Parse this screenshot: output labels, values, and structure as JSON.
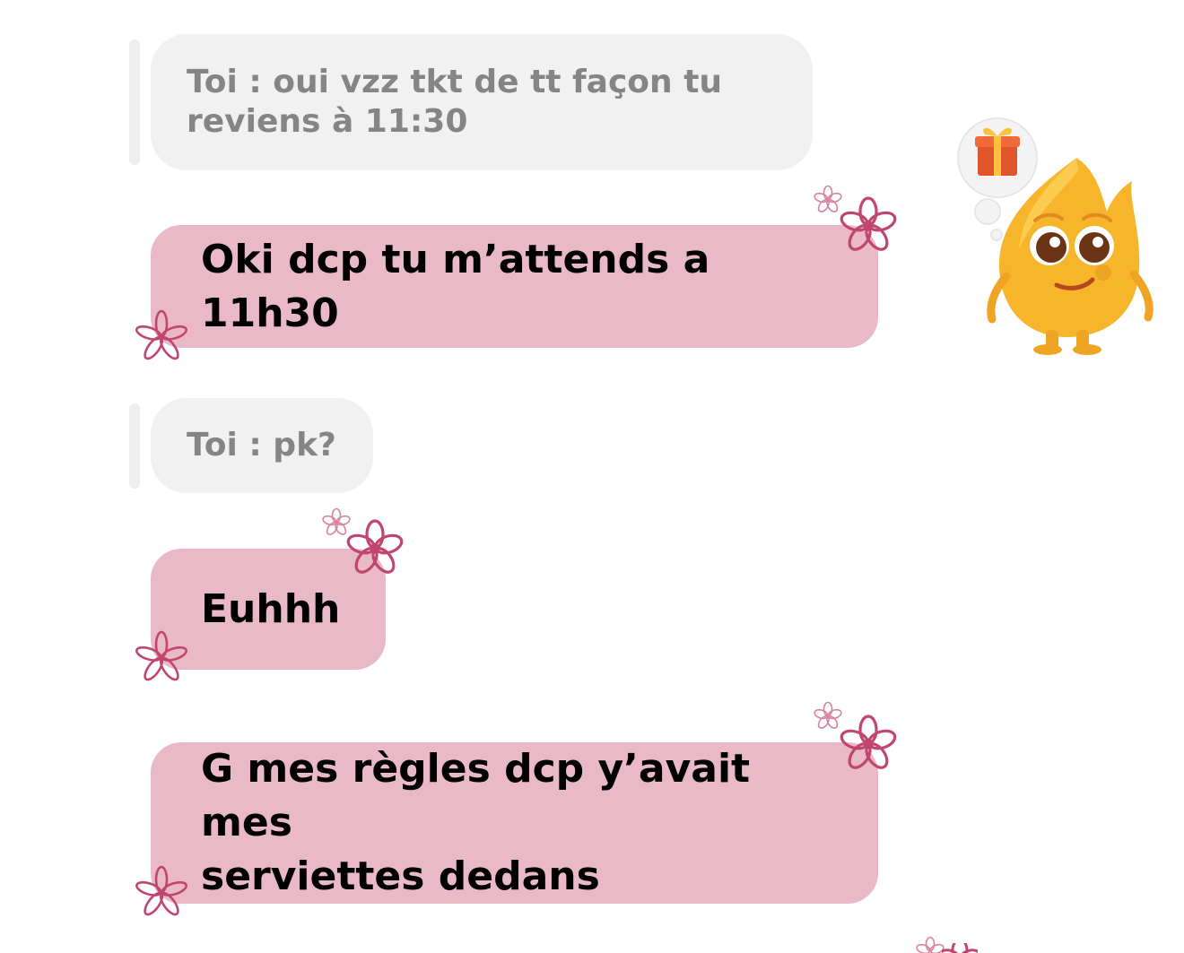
{
  "conversation": {
    "messages": [
      {
        "type": "quote",
        "text": "Toi : oui vzz tkt de tt façon tu\nreviens à 11:30"
      },
      {
        "type": "message",
        "text": "Oki dcp tu m’attends a 11h30"
      },
      {
        "type": "quote",
        "text": "Toi : pk?"
      },
      {
        "type": "message",
        "text": "Euhhh"
      },
      {
        "type": "message",
        "text": "G mes règles dcp y’avait mes\nserviettes dedans"
      }
    ]
  },
  "colors": {
    "bubble_pink": "#eab9c8",
    "quote_grey": "#f1f1f1",
    "quote_text": "#858585",
    "flower_stroke": "#c0466e"
  },
  "icons": {
    "flower": "flower-sticker-icon",
    "gift": "gift-icon",
    "mascot": "flame-mascot-sticker"
  }
}
